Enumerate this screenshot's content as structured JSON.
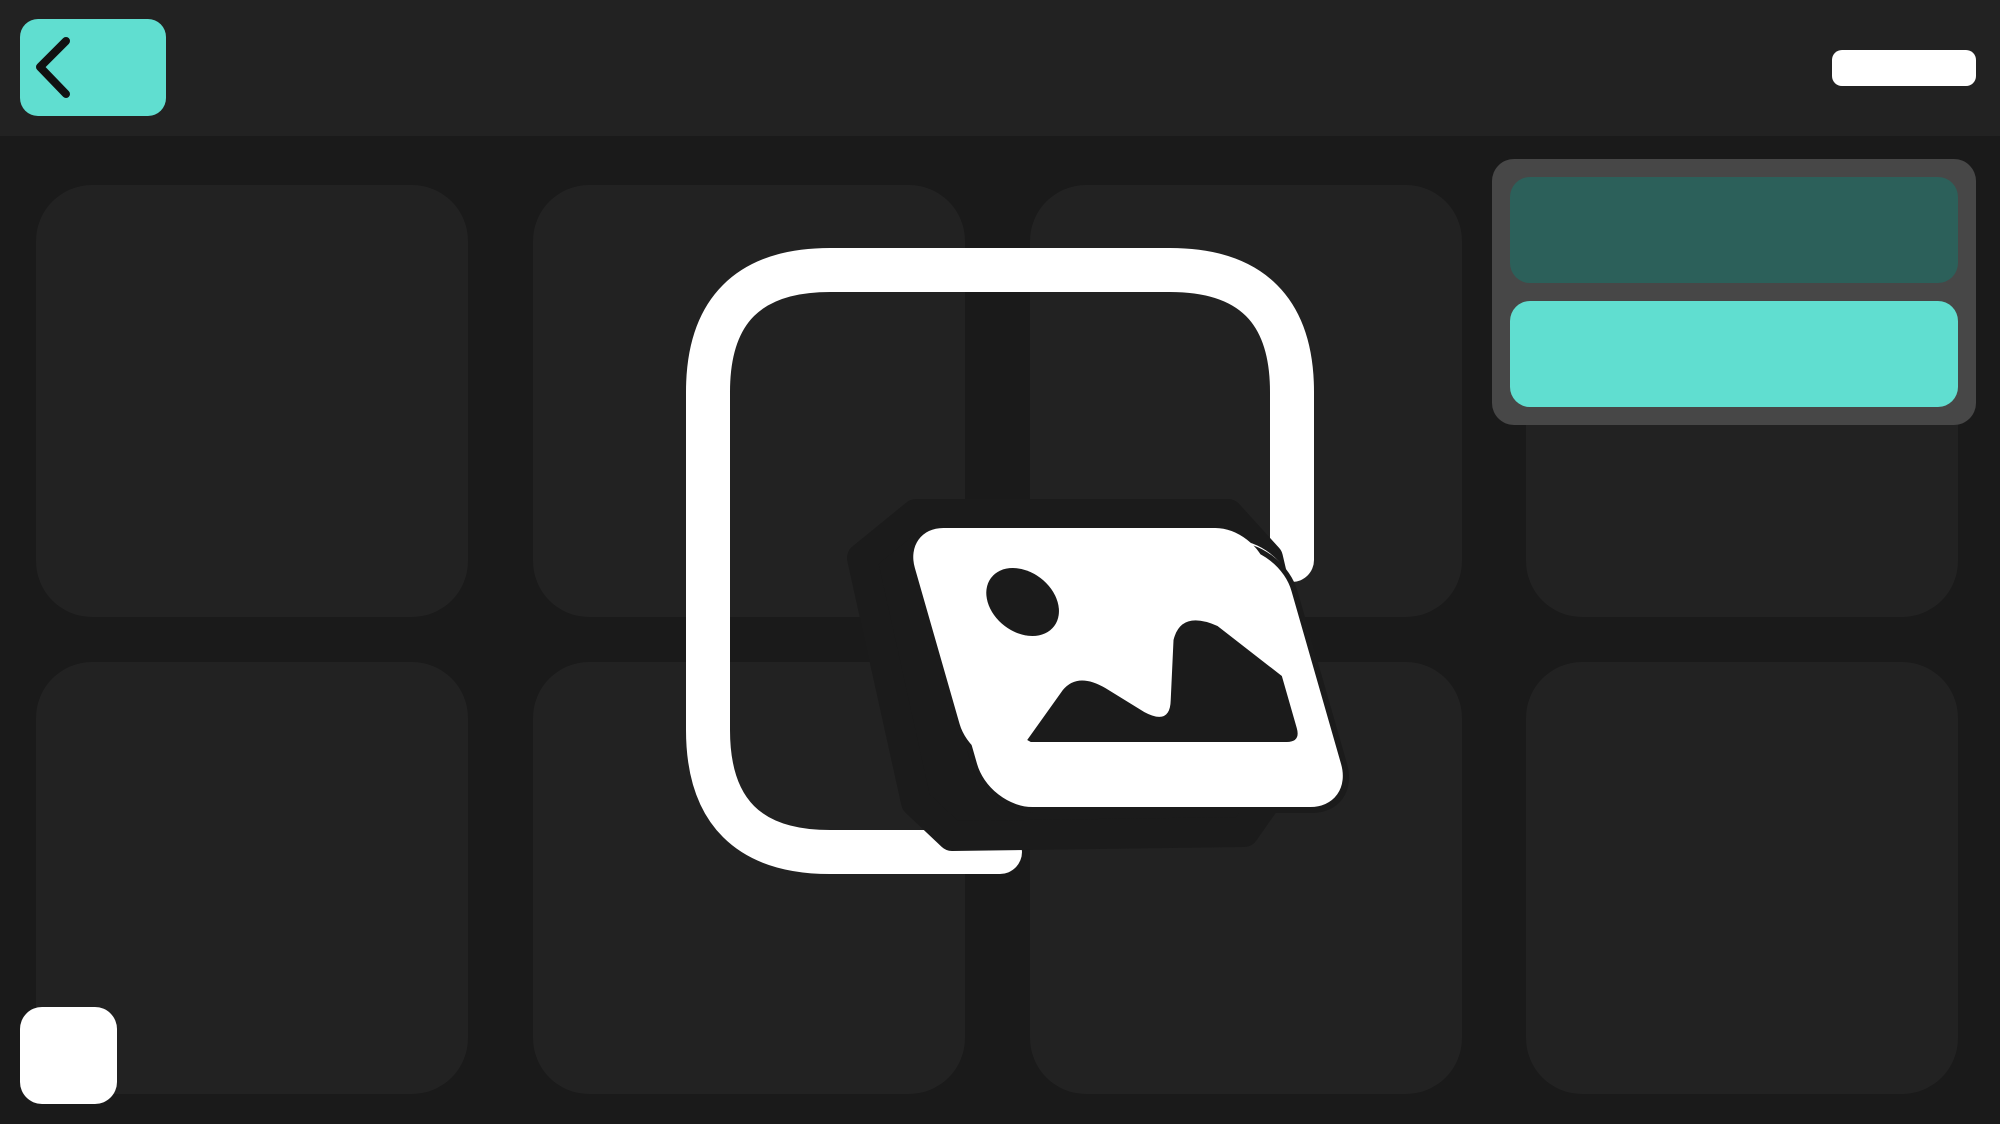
{
  "theme": {
    "background": "#1a1a1a",
    "topbar": "#222222",
    "tile": "#222222",
    "accent": "#60ded0",
    "accent_dark": "#2c605a",
    "panel": "#474747",
    "icon_fill": "#ffffff"
  },
  "topbar": {
    "back_icon": "chevron-left-icon"
  },
  "grid": {
    "rows": 2,
    "columns": 4
  },
  "menu": {
    "items": [
      {
        "name": "menu-option-1",
        "state": "unselected"
      },
      {
        "name": "menu-option-2",
        "state": "highlighted"
      }
    ]
  },
  "center": {
    "icon": "add-image-icon"
  }
}
